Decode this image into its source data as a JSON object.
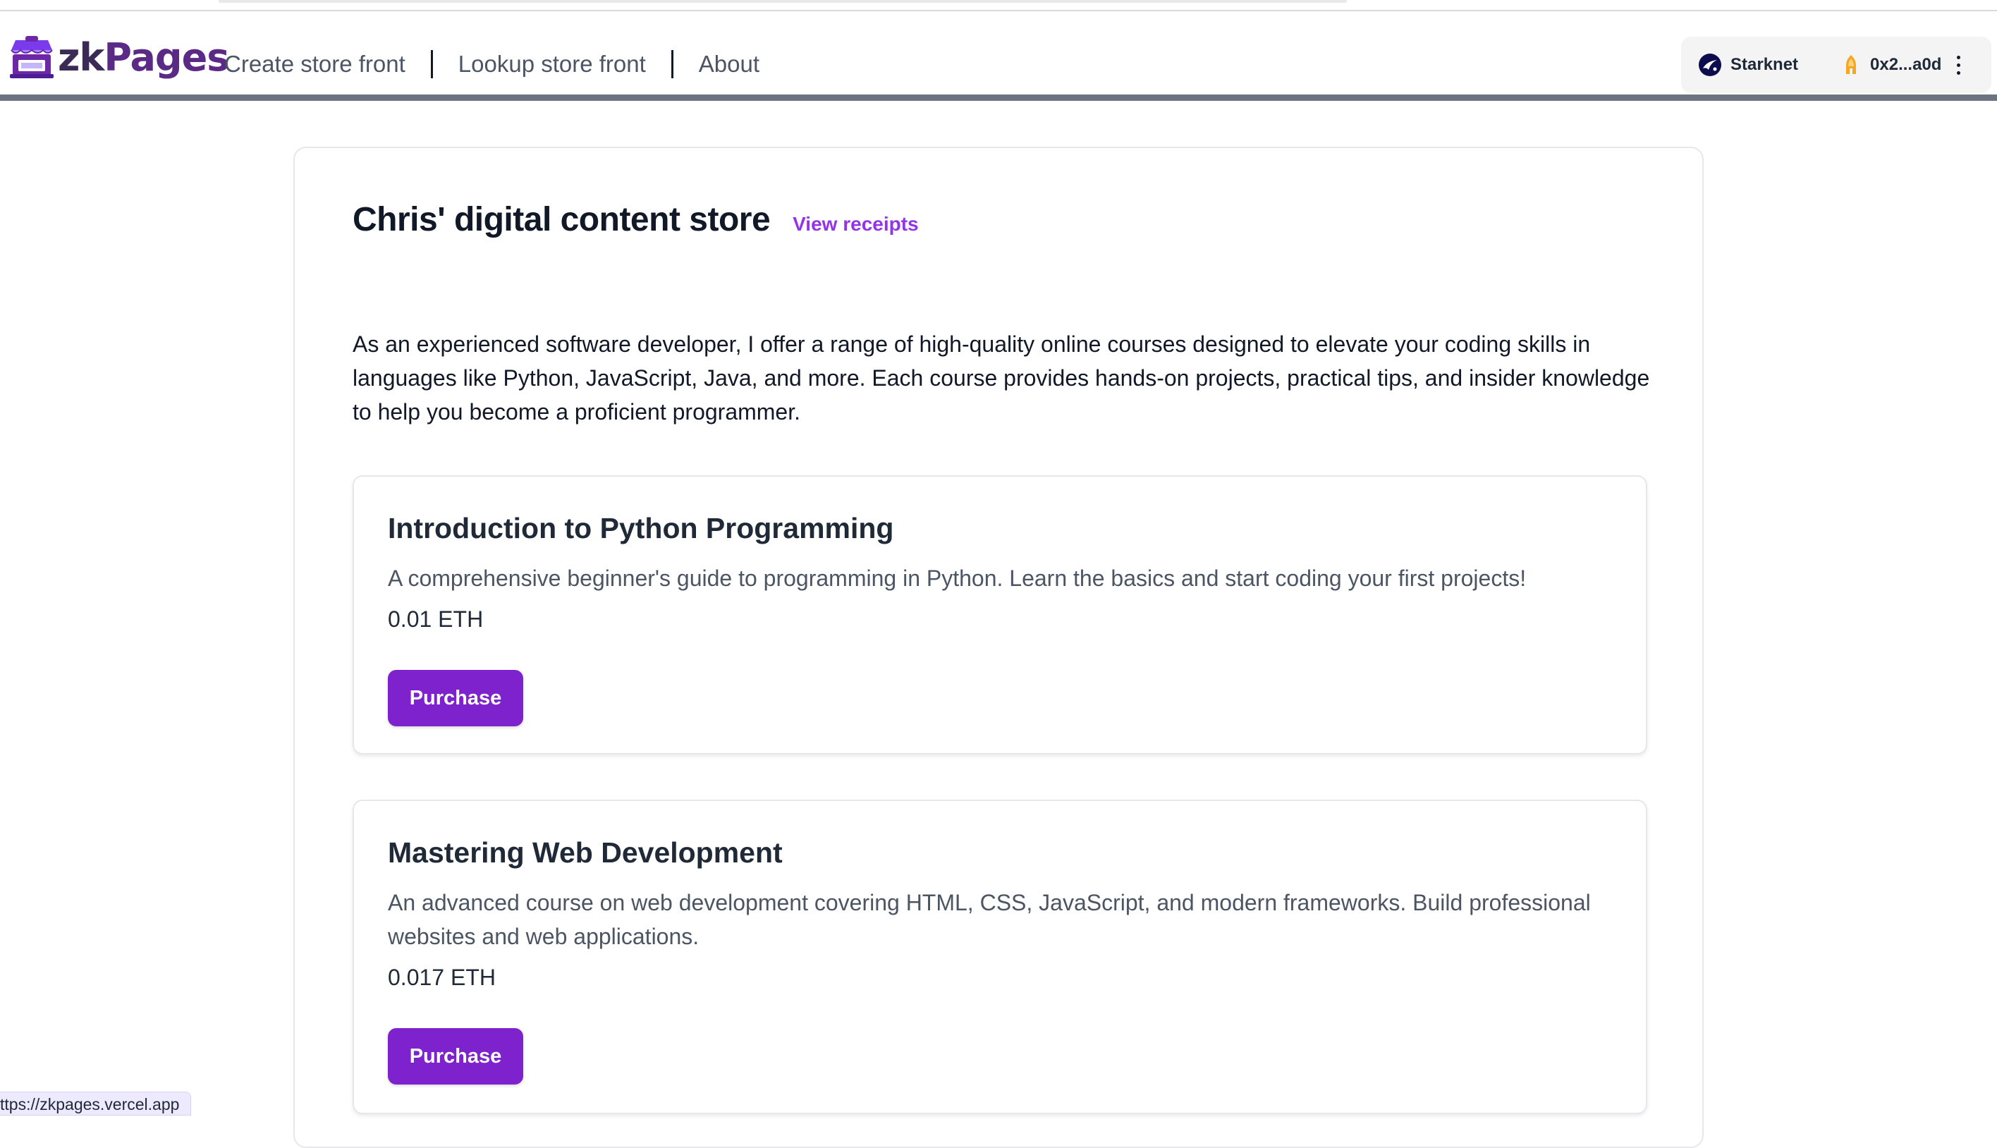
{
  "brand": {
    "name_prefix": "zk",
    "name_suffix": "Pages"
  },
  "nav": {
    "items": [
      "Create store front",
      "Lookup store front",
      "About"
    ]
  },
  "wallet": {
    "network": "Starknet",
    "account": "0x2...a0d",
    "network_icon": "starknet-icon",
    "account_icon": "argent-wallet-icon",
    "more_icon": "vertical-ellipsis-icon"
  },
  "store": {
    "title": "Chris' digital content store",
    "view_receipts": "View receipts",
    "description": "As an experienced software developer, I offer a range of high-quality online courses designed to elevate your coding skills in languages like Python, JavaScript, Java, and more. Each course provides hands-on projects, practical tips, and insider knowledge to help you become a proficient programmer."
  },
  "products": [
    {
      "title": "Introduction to Python Programming",
      "description": "A comprehensive beginner's guide to programming in Python. Learn the basics and start coding your first projects!",
      "price": "0.01 ETH",
      "button": "Purchase"
    },
    {
      "title": "Mastering Web Development",
      "description": "An advanced course on web development covering HTML, CSS, JavaScript, and modern frameworks. Build professional websites and web applications.",
      "price": "0.017 ETH",
      "button": "Purchase"
    }
  ],
  "status_bar": {
    "url": "ttps://zkpages.vercel.app"
  },
  "colors": {
    "accent": "#7e22ce",
    "link": "#9333ea",
    "brand_dark": "#3b2a55",
    "brand_purple": "#5b2a86",
    "header_rule": "#6b7280"
  }
}
